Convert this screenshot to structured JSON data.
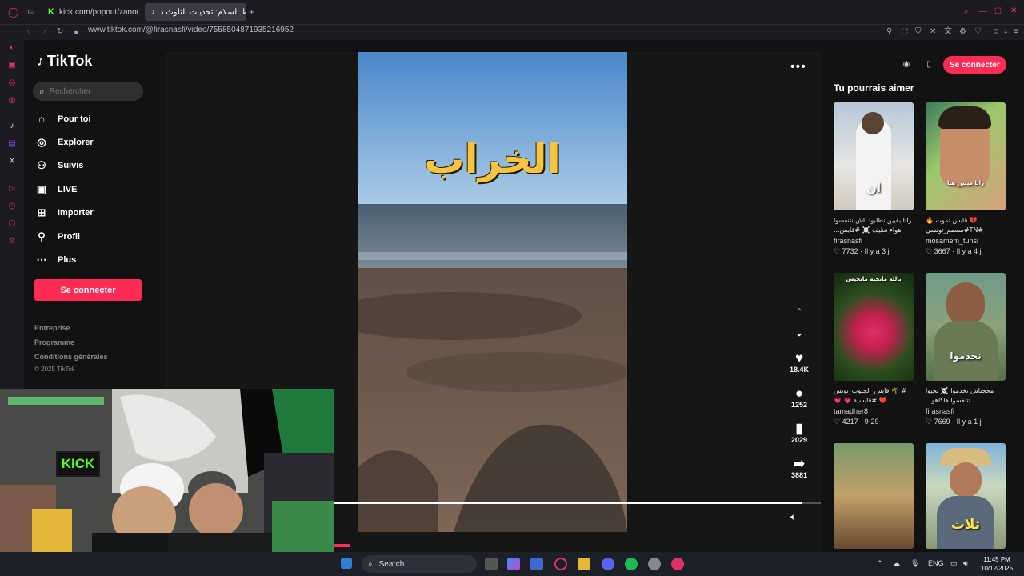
{
  "browser": {
    "tabs": [
      {
        "label": "kick.com/popout/zanoun"
      },
      {
        "label": "شط السلام: تحديات التلوث د"
      }
    ],
    "url": "www.tiktok.com/@firasnasfi/video/7558504871935216952"
  },
  "sidebar": {
    "brand": "TikTok",
    "search_placeholder": "Rechercher",
    "nav": [
      {
        "label": "Pour toi",
        "icon": "home-icon"
      },
      {
        "label": "Explorer",
        "icon": "compass-icon"
      },
      {
        "label": "Suivis",
        "icon": "following-icon"
      },
      {
        "label": "LIVE",
        "icon": "live-icon"
      },
      {
        "label": "Importer",
        "icon": "upload-icon"
      },
      {
        "label": "Profil",
        "icon": "profile-icon"
      },
      {
        "label": "Plus",
        "icon": "more-icon"
      }
    ],
    "login_label": "Se connecter",
    "footer": [
      "Entreprise",
      "Programme",
      "Conditions générales",
      "© 2025 TikTok"
    ]
  },
  "video": {
    "overlay_text": "الخراب",
    "progress": 0.96,
    "actions": {
      "likes": "18.4K",
      "comments": "1252",
      "saves": "2029",
      "shares": "3881"
    }
  },
  "right": {
    "login_label": "Se connecter",
    "title": "Tu pourrais aimer",
    "cards": [
      {
        "caption": "رانا بقيين نطلبوا باش نتنفسوا هواء نظيف ☠️ #قابس...",
        "user": "firasnasfi",
        "likes": "7732",
        "time": "Il y a 3 j",
        "thumb_text": "ان"
      },
      {
        "caption": "💔 قابس تموت 🔥#TN#مسمم_تونسي",
        "user": "mosamem_tunsi",
        "likes": "3667",
        "time": "Il y a 4 j",
        "thumb_text": "رانا ميتين هنا"
      },
      {
        "caption": "# 🌴 قابس_الجنوب_تونس❤️ #قابسية 💗 💗 #قابس...",
        "user": "tamadher8",
        "likes": "4217",
        "time": "9-29",
        "thumb_text": "بالله ماتجيه ماتجيش"
      },
      {
        "caption": "محجتاش نخدموا ☠️ نحبوا نتنفسوا هاكاهو...",
        "user": "firasnasfi",
        "likes": "7669",
        "time": "Il y a 1 j",
        "thumb_text": "نخدموا"
      },
      {
        "caption": "",
        "user": "",
        "likes": "",
        "time": "",
        "thumb_text": ""
      },
      {
        "caption": "",
        "user": "",
        "likes": "",
        "time": "",
        "thumb_text": "ثلاث"
      }
    ]
  },
  "webcam": {
    "sign_text": "KICK"
  },
  "taskbar": {
    "search_label": "Search",
    "language": "ENG",
    "time": "11:45 PM",
    "date": "10/12/2025"
  },
  "colors": {
    "accent": "#fe2c55",
    "background": "#121212",
    "kick_green": "#53fc18"
  }
}
